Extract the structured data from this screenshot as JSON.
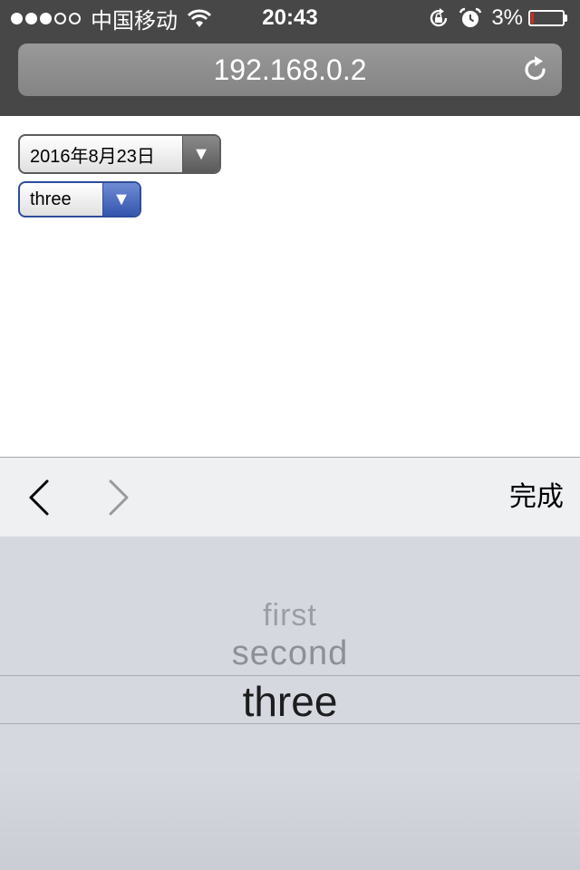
{
  "status_bar": {
    "signal_bars_filled": 3,
    "signal_bars_total": 5,
    "carrier": "中国移动",
    "wifi_icon": "wifi-icon",
    "time": "20:43",
    "rotation_lock_icon": "rotation-lock-icon",
    "alarm_icon": "alarm-icon",
    "battery_percent_text": "3%",
    "battery_level": 0.03,
    "battery_color": "#e0261b"
  },
  "browser": {
    "url": "192.168.0.2",
    "reload_icon": "reload-icon"
  },
  "page": {
    "date_select": {
      "value": "2016年8月23日",
      "arrow_icon": "triangle-down-icon"
    },
    "option_select": {
      "value": "three",
      "arrow_icon": "triangle-down-icon",
      "accent_color": "#3556ae"
    }
  },
  "keyboard_toolbar": {
    "prev_icon": "chevron-left-icon",
    "next_icon": "chevron-right-icon",
    "done_label": "完成"
  },
  "picker": {
    "options": [
      "first",
      "second",
      "three"
    ],
    "selected": "three"
  }
}
